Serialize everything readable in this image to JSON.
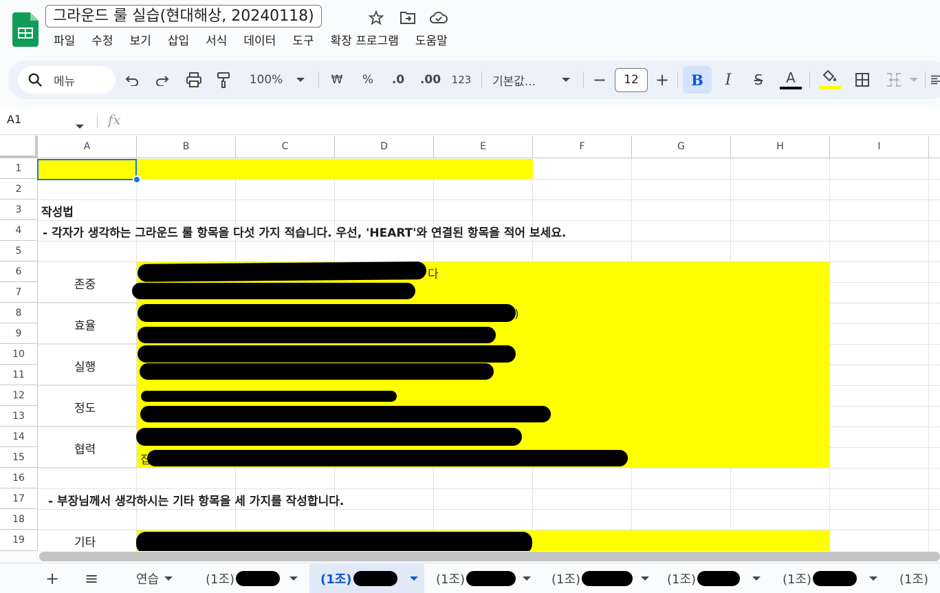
{
  "app": {
    "title": "그라운드 룰 실습(현대해상, 20240118)"
  },
  "menu": [
    "파일",
    "수정",
    "보기",
    "삽입",
    "서식",
    "데이터",
    "도구",
    "확장 프로그램",
    "도움말"
  ],
  "toolbar": {
    "search_label": "메뉴",
    "zoom": "100%",
    "currency": "₩",
    "percent": "%",
    "dec_decrease": ".0",
    "dec_increase": ".00",
    "number_format": "123",
    "font": "기본값...",
    "font_size": "12",
    "bold": "B",
    "italic": "I",
    "strike": "S",
    "text_color": "A",
    "text_color_hex": "#000000",
    "fill_color_hex": "#ffff00"
  },
  "formula_bar": {
    "name_box": "A1",
    "fx": "fx"
  },
  "columns": [
    "A",
    "B",
    "C",
    "D",
    "E",
    "F",
    "G",
    "H",
    "I"
  ],
  "rows": [
    "1",
    "2",
    "3",
    "4",
    "5",
    "6",
    "7",
    "8",
    "9",
    "10",
    "11",
    "12",
    "13",
    "14",
    "15",
    "16",
    "17",
    "18",
    "19"
  ],
  "cells": {
    "a3": "작성법",
    "a4": "- 각자가 생각하는 그라운드 룰 항목을 다섯 가지 적습니다. 우선, 'HEART'와 연결된 항목을 적어 보세요.",
    "a6": "존중",
    "a8": "효율",
    "a10": "실행",
    "a12": "정도",
    "a14": "협력",
    "a17": "- 부장님께서 생각하시는 기타 항목을 세 가지를 작성합니다.",
    "a19": "기타",
    "b6_visible": "다",
    "b8_visible": ")",
    "b15_visible": "집"
  },
  "sheet_tabs": {
    "add": "+",
    "list": "≡",
    "tabs": [
      {
        "label": "연습",
        "active": false
      },
      {
        "label": "(1조)",
        "active": false
      },
      {
        "label": "(1조)",
        "active": true
      },
      {
        "label": "(1조)",
        "active": false
      },
      {
        "label": "(1조)",
        "active": false
      },
      {
        "label": "(1조)",
        "active": false
      },
      {
        "label": "(1조)",
        "active": false
      },
      {
        "label": "(1조)",
        "active": false
      }
    ]
  },
  "colors": {
    "accent": "#0b57d0",
    "highlight": "#ffff00",
    "sheets_green": "#0f9d58"
  }
}
